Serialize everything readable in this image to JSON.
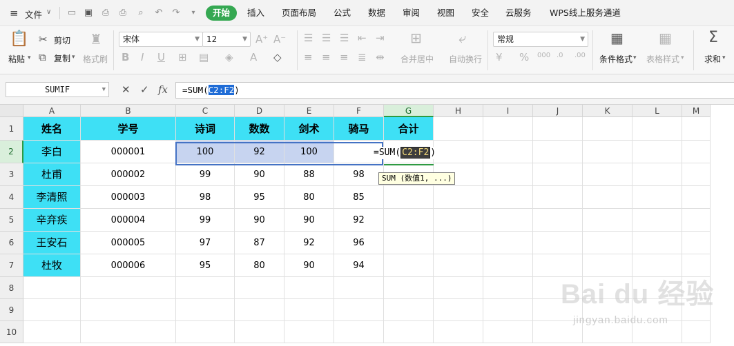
{
  "menubar": {
    "file_label": "文件",
    "tabs": [
      "开始",
      "插入",
      "页面布局",
      "公式",
      "数据",
      "审阅",
      "视图",
      "安全",
      "云服务",
      "WPS线上服务通道"
    ],
    "active_tab": "开始",
    "accent_color": "#35a852"
  },
  "ribbon": {
    "paste": "粘贴",
    "cut": "剪切",
    "copy": "复制",
    "format_painter": "格式刷",
    "font_name": "宋体",
    "font_size": "12",
    "merge_center": "合并居中",
    "wrap_text": "自动换行",
    "number_format": "常规",
    "conditional_format": "条件格式",
    "table_style": "表格样式",
    "sum": "求和"
  },
  "formula_bar": {
    "name_box": "SUMIF",
    "cancel_icon": "✕",
    "accept_icon": "✓",
    "fx_icon": "fx",
    "formula_prefix": "=SUM(",
    "formula_ref": "C2:F2",
    "formula_suffix": ")"
  },
  "grid": {
    "columns": [
      "A",
      "B",
      "C",
      "D",
      "E",
      "F",
      "G",
      "H",
      "I",
      "J",
      "K",
      "L",
      "M"
    ],
    "rows": [
      "1",
      "2",
      "3",
      "4",
      "5",
      "6",
      "7",
      "8",
      "9",
      "10"
    ],
    "header_row": [
      "姓名",
      "学号",
      "诗词",
      "数数",
      "剑术",
      "骑马",
      "合计"
    ],
    "data": [
      [
        "李白",
        "000001",
        "100",
        "92",
        "100",
        ""
      ],
      [
        "杜甫",
        "000002",
        "99",
        "90",
        "88",
        "98"
      ],
      [
        "李清照",
        "000003",
        "98",
        "95",
        "80",
        "85"
      ],
      [
        "辛弃疾",
        "000004",
        "99",
        "90",
        "90",
        "92"
      ],
      [
        "王安石",
        "000005",
        "97",
        "87",
        "92",
        "96"
      ],
      [
        "杜牧",
        "000006",
        "95",
        "80",
        "90",
        "94"
      ]
    ],
    "header_fill": "#3ee0f5",
    "in_cell_prefix": "=SUM(",
    "in_cell_ref": "C2:F2",
    "in_cell_suffix": ")",
    "tooltip": "SUM (数值1, ...)"
  },
  "watermark": {
    "logo": "Bai du 经验",
    "url": "jingyan.baidu.com"
  }
}
